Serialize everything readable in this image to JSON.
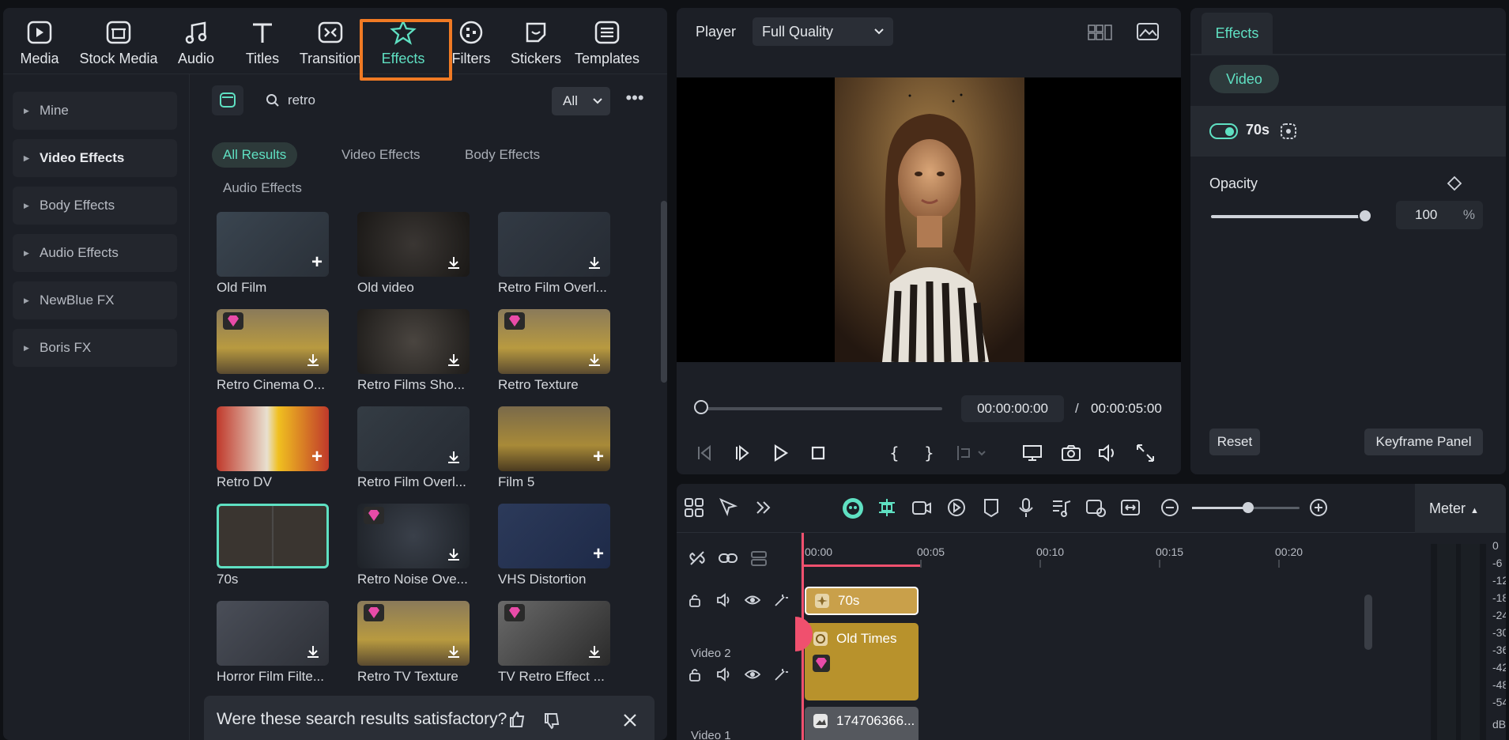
{
  "toolbar": {
    "items": [
      {
        "label": "Media",
        "icon": "media-icon"
      },
      {
        "label": "Stock Media",
        "icon": "stock-media-icon"
      },
      {
        "label": "Audio",
        "icon": "audio-icon"
      },
      {
        "label": "Titles",
        "icon": "titles-icon"
      },
      {
        "label": "Transition",
        "icon": "transition-icon"
      },
      {
        "label": "Effects",
        "icon": "effects-icon",
        "active": true
      },
      {
        "label": "Filters",
        "icon": "filters-icon"
      },
      {
        "label": "Stickers",
        "icon": "stickers-icon"
      },
      {
        "label": "Templates",
        "icon": "templates-icon"
      }
    ]
  },
  "sidebar": {
    "items": [
      {
        "label": "Mine"
      },
      {
        "label": "Video Effects"
      },
      {
        "label": "Body Effects"
      },
      {
        "label": "Audio Effects"
      },
      {
        "label": "NewBlue FX"
      },
      {
        "label": "Boris FX"
      }
    ]
  },
  "search": {
    "value": "retro",
    "filter": "All"
  },
  "chips": [
    "All Results",
    "Video Effects",
    "Body Effects",
    "Audio Effects"
  ],
  "effects": [
    {
      "label": "Old Film",
      "badge": "add"
    },
    {
      "label": "Old video",
      "badge": "download"
    },
    {
      "label": "Retro Film Overl...",
      "badge": "download"
    },
    {
      "label": "Retro Cinema O...",
      "badge": "download",
      "premium": true
    },
    {
      "label": "Retro Films Sho...",
      "badge": "download"
    },
    {
      "label": "Retro Texture",
      "badge": "download",
      "premium": true
    },
    {
      "label": "Retro DV",
      "badge": "add"
    },
    {
      "label": "Retro Film Overl...",
      "badge": "download"
    },
    {
      "label": "Film 5",
      "badge": "add"
    },
    {
      "label": "70s",
      "badge": "none",
      "selected": true
    },
    {
      "label": "Retro Noise Ove...",
      "badge": "download",
      "premium": true
    },
    {
      "label": "VHS Distortion",
      "badge": "add"
    },
    {
      "label": "Horror Film Filte...",
      "badge": "download"
    },
    {
      "label": "Retro TV Texture",
      "badge": "download",
      "premium": true
    },
    {
      "label": "TV Retro Effect ...",
      "badge": "download",
      "premium": true
    }
  ],
  "feedback": {
    "text": "Were these search results satisfactory?"
  },
  "player": {
    "title": "Player",
    "quality": "Full Quality",
    "current_time": "00:00:00:00",
    "separator": "/",
    "total_time": "00:00:05:00"
  },
  "props": {
    "tab": "Effects",
    "section": "Video",
    "effect_name": "70s",
    "opacity_label": "Opacity",
    "opacity_value": "100",
    "opacity_unit": "%",
    "opacity_level": 1.0,
    "reset": "Reset",
    "keyframe": "Keyframe Panel"
  },
  "timeline": {
    "meter_label": "Meter",
    "ruler": [
      "00:00",
      "00:05",
      "00:10",
      "00:15",
      "00:20"
    ],
    "tracks": [
      "Video 2",
      "Video 1"
    ],
    "clips": {
      "effect": "70s",
      "filter": "Old Times",
      "video": "174706366..."
    },
    "db_scale": [
      "0",
      "-6",
      "-12",
      "-18",
      "-24",
      "-30",
      "-36",
      "-42",
      "-48",
      "-54",
      "dB"
    ]
  },
  "colors": {
    "accent": "#5fe0c2",
    "highlight": "#f07a24",
    "playhead": "#f0506e",
    "premium": "#e94ba8"
  }
}
